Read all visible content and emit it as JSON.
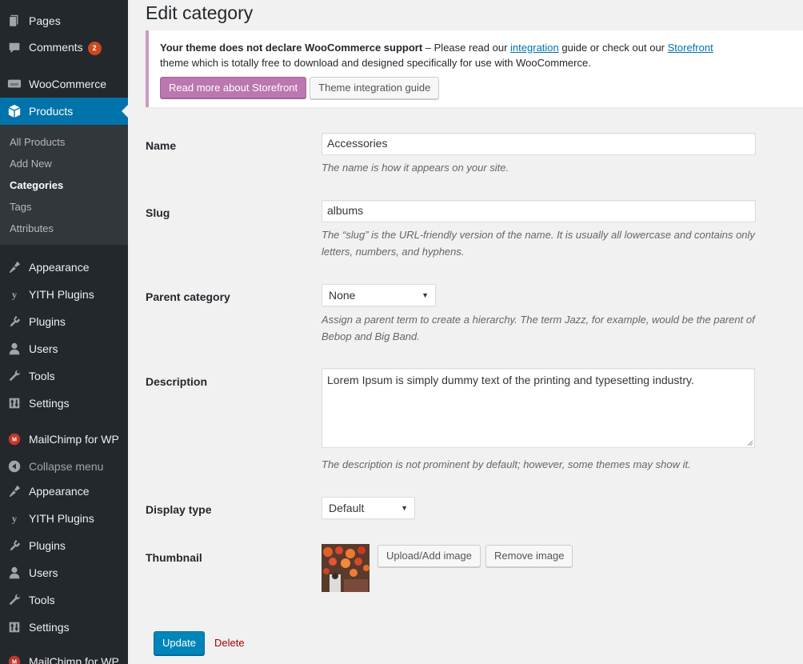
{
  "sidebar": {
    "top_items": [
      {
        "label": "Pages",
        "icon": "pages-icon"
      },
      {
        "label": "Comments",
        "icon": "comments-icon",
        "badge": "2"
      },
      {
        "label": "WooCommerce",
        "icon": "woocommerce-icon"
      },
      {
        "label": "Products",
        "icon": "products-icon"
      }
    ],
    "submenu": [
      "All Products",
      "Add New",
      "Categories",
      "Tags",
      "Attributes"
    ],
    "bottom_items": [
      {
        "label": "Appearance",
        "icon": "appearance-icon"
      },
      {
        "label": "YITH Plugins",
        "icon": "yith-icon"
      },
      {
        "label": "Plugins",
        "icon": "plugins-icon"
      },
      {
        "label": "Users",
        "icon": "users-icon"
      },
      {
        "label": "Tools",
        "icon": "tools-icon"
      },
      {
        "label": "Settings",
        "icon": "settings-icon"
      },
      {
        "label": "MailChimp for WP",
        "icon": "mailchimp-icon"
      },
      {
        "label": "Collapse menu",
        "icon": "collapse-icon"
      },
      {
        "label": "Appearance",
        "icon": "appearance-icon"
      },
      {
        "label": "YITH Plugins",
        "icon": "yith-icon"
      },
      {
        "label": "Plugins",
        "icon": "plugins-icon"
      },
      {
        "label": "Users",
        "icon": "users-icon"
      },
      {
        "label": "Tools",
        "icon": "tools-icon"
      },
      {
        "label": "Settings",
        "icon": "settings-icon"
      },
      {
        "label": "MailChimp for WP",
        "icon": "mailchimp-icon"
      }
    ],
    "active_color": "#0073aa",
    "bg_color": "#23282d"
  },
  "page": {
    "title": "Edit category"
  },
  "notice": {
    "bold": "Your theme does not declare WooCommerce support",
    "text1": " – Please read our ",
    "link1": "integration",
    "text2": " guide or check out our ",
    "link2": "Storefront",
    "text3": "theme which is totally free to download and designed specifically for use with WooCommerce.",
    "button_primary": "Read more about Storefront",
    "button_secondary": "Theme integration guide",
    "accent_color": "#bb77ae"
  },
  "form": {
    "name": {
      "label": "Name",
      "value": "Accessories",
      "help": "The name is how it appears on your site."
    },
    "slug": {
      "label": "Slug",
      "value": "albums",
      "help_line1": "The “slug” is the URL-friendly version of the name. It is usually all lowercase and contains only",
      "help_line2": "letters, numbers, and hyphens."
    },
    "parent": {
      "label": "Parent category",
      "value": "None",
      "help_line1": "Assign a parent term to create a hierarchy. The term Jazz, for example, would be the parent of",
      "help_line2": "Bebop and Big Band."
    },
    "description": {
      "label": "Description",
      "value": "Lorem Ipsum is simply dummy text of the printing and typesetting industry.",
      "help": "The description is not prominent by default; however, some themes may show it."
    },
    "display_type": {
      "label": "Display type",
      "value": "Default"
    },
    "thumbnail": {
      "label": "Thumbnail",
      "upload_label": "Upload/Add image",
      "remove_label": "Remove image"
    }
  },
  "actions": {
    "update": "Update",
    "delete": "Delete"
  }
}
